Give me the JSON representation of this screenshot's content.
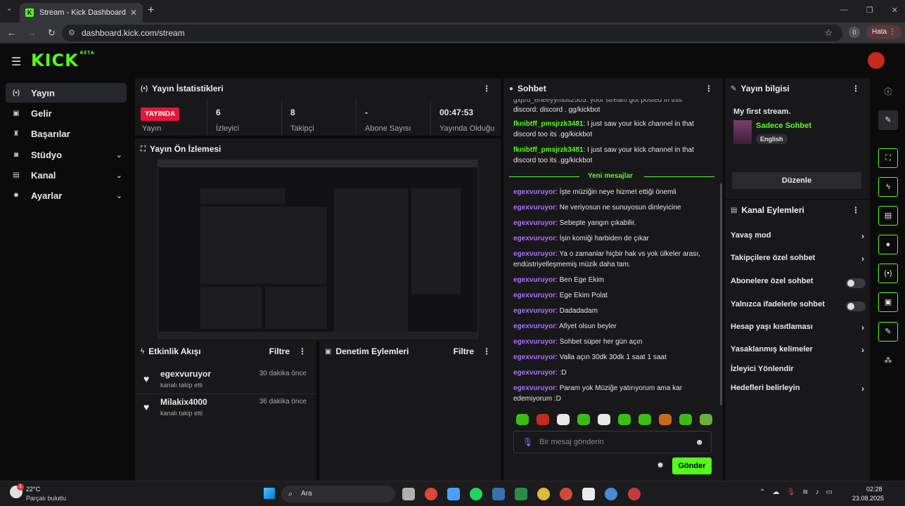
{
  "browser": {
    "tab_title": "Stream - Kick Dashboard",
    "tab_close": "✕",
    "new_tab": "+",
    "url": "dashboard.kick.com/stream",
    "profile_initial": "0",
    "error_pill": "Hata"
  },
  "kick": {
    "logo": "KICK",
    "logo_beta": "BETA"
  },
  "sidebar": {
    "items": [
      {
        "label": "Yayın",
        "icon": "stream-icon"
      },
      {
        "label": "Gelir",
        "icon": "revenue-icon"
      },
      {
        "label": "Başarılar",
        "icon": "trophy-icon"
      },
      {
        "label": "Stüdyo",
        "icon": "studio-icon"
      },
      {
        "label": "Kanal",
        "icon": "channel-icon"
      },
      {
        "label": "Ayarlar",
        "icon": "gear-icon"
      }
    ]
  },
  "stats": {
    "title": "Yayın İstatistikleri",
    "live_badge": "YAYINDA",
    "live_label": "Yayın",
    "cells": [
      {
        "value": "6",
        "label": "İzleyici"
      },
      {
        "value": "8",
        "label": "Takipçi"
      },
      {
        "value": "-",
        "label": "Abone Sayısı"
      },
      {
        "value": "00:47:53",
        "label": "Yayında Olduğu"
      }
    ]
  },
  "preview": {
    "title": "Yayın Ön İzlemesi"
  },
  "events": {
    "title": "Etkinlik Akışı",
    "filter": "Filtre",
    "items": [
      {
        "name": "egexvuruyor",
        "desc": "kanalı takip etti",
        "time": "30 dakika önce"
      },
      {
        "name": "Milakix4000",
        "desc": "kanalı takip etti",
        "time": "36 dakika önce"
      }
    ]
  },
  "moderation": {
    "title": "Denetim Eylemleri",
    "filter": "Filtre"
  },
  "chat": {
    "title": "Sohbet",
    "top_partial": "gxjtru_eneeyymbs2505: your stream got posted in this",
    "messages_before": [
      {
        "user": "",
        "text": "discord: discord . gg/kickbot"
      },
      {
        "user": "fknibtff_pmsjrzk3481",
        "text": "I just saw your kick channel in that discord too its .gg/kickbot"
      },
      {
        "user": "fknibtff_pmsjrzk3481",
        "text": "I just saw your kick channel in that discord too its .gg/kickbot"
      }
    ],
    "new_messages_label": "Yeni mesajlar",
    "messages": [
      {
        "user": "egexvuruyor",
        "text": "İşte müziğin neye hizmet ettiği önemli"
      },
      {
        "user": "egexvuruyor",
        "text": "Ne veriyosun ne sunuyosun dinleyicine"
      },
      {
        "user": "egexvuruyor",
        "text": "Sebepte yangın çıkabilir."
      },
      {
        "user": "egexvuruyor",
        "text": "İşin komiği harbiden de çıkar"
      },
      {
        "user": "egexvuruyor",
        "text": "Ya o zamanlar hiçbir hak vs yok ülkeler arası, endüstriyelleşmemiş müzik daha tam."
      },
      {
        "user": "egexvuruyor",
        "text": "Ben Ege Ekim"
      },
      {
        "user": "egexvuruyor",
        "text": "Ege Ekim Polat"
      },
      {
        "user": "egexvuruyor",
        "text": "Dadadadam"
      },
      {
        "user": "egexvuruyor",
        "text": "Afiyet olsun beyler"
      },
      {
        "user": "egexvuruyor",
        "text": "Sohbet süper her gün açın"
      },
      {
        "user": "egexvuruyor",
        "text": "Valla açın 30dk 30dk 1 saat 1 saat"
      },
      {
        "user": "egexvuruyor",
        "text": ":D"
      },
      {
        "user": "egexvuruyor",
        "text": "Param yok Müziğe yatırıyorum ama kar edemiyorum :D"
      }
    ],
    "input_placeholder": "Bir mesaj gönderin",
    "send_label": "Gönder"
  },
  "info": {
    "title": "Yayın bilgisi",
    "stream_title": "My first stream.",
    "category": "Sadece Sohbet",
    "language": "English",
    "edit_label": "Düzenle"
  },
  "channel_actions": {
    "title": "Kanal Eylemleri",
    "items": [
      {
        "label": "Yavaş mod",
        "kind": "chevron"
      },
      {
        "label": "Takipçilere özel sohbet",
        "kind": "chevron"
      },
      {
        "label": "Abonelere özel sohbet",
        "kind": "toggle"
      },
      {
        "label": "Yalnızca ifadelerle sohbet",
        "kind": "toggle"
      },
      {
        "label": "Hesap yaşı kısıtlaması",
        "kind": "chevron"
      },
      {
        "label": "Yasaklanmış kelimeler",
        "kind": "chevron"
      },
      {
        "label": "İzleyici Yönlendir",
        "kind": "none"
      },
      {
        "label": "Hedefleri belirleyin",
        "kind": "chevron"
      }
    ]
  },
  "taskbar": {
    "weather_temp": "22°C",
    "weather_desc": "Parçalı bulutlu",
    "weather_badge": "1",
    "search_placeholder": "Ara",
    "time": "02:28",
    "date": "23.08.2025"
  },
  "colors": {
    "accent": "#53fc18",
    "live": "#e3163c",
    "username": "#a970ff",
    "panel": "#18181b"
  }
}
